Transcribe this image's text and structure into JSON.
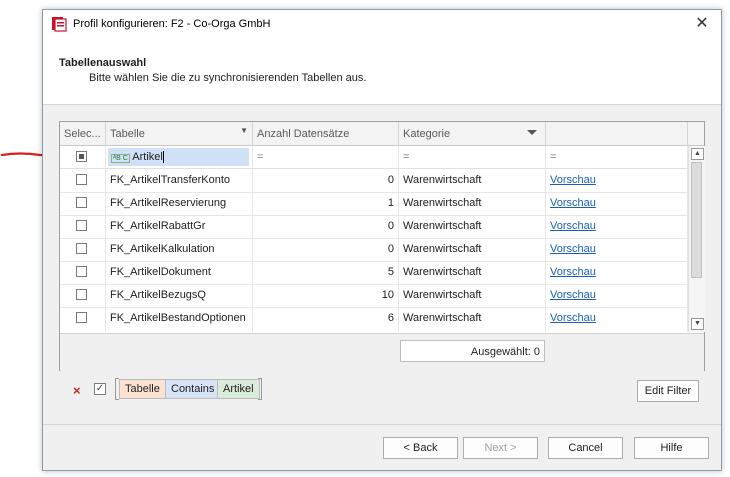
{
  "window": {
    "title": "Profil konfigurieren: F2 - Co-Orga GmbH",
    "close": "✕"
  },
  "header": {
    "title": "Tabellenauswahl",
    "subtitle": "Bitte wählen Sie die zu synchronisierenden Tabellen aus."
  },
  "grid": {
    "columns": [
      "Selec...",
      "Tabelle",
      "Anzahl Datensätze",
      "Kategorie",
      ""
    ],
    "filter_row": {
      "tabelle_prefix": "ᴬB C",
      "tabelle_value": "Artikel",
      "anzahl": "=",
      "kategorie": "=",
      "extra": "="
    },
    "rows": [
      {
        "tabelle": "FK_ArtikelTransferKonto",
        "anzahl": "0",
        "kategorie": "Warenwirtschaft",
        "link": "Vorschau"
      },
      {
        "tabelle": "FK_ArtikelReservierung",
        "anzahl": "1",
        "kategorie": "Warenwirtschaft",
        "link": "Vorschau"
      },
      {
        "tabelle": "FK_ArtikelRabattGr",
        "anzahl": "0",
        "kategorie": "Warenwirtschaft",
        "link": "Vorschau"
      },
      {
        "tabelle": "FK_ArtikelKalkulation",
        "anzahl": "0",
        "kategorie": "Warenwirtschaft",
        "link": "Vorschau"
      },
      {
        "tabelle": "FK_ArtikelDokument",
        "anzahl": "5",
        "kategorie": "Warenwirtschaft",
        "link": "Vorschau"
      },
      {
        "tabelle": "FK_ArtikelBezugsQ",
        "anzahl": "10",
        "kategorie": "Warenwirtschaft",
        "link": "Vorschau"
      },
      {
        "tabelle": "FK_ArtikelBestandOptionen",
        "anzahl": "6",
        "kategorie": "Warenwirtschaft",
        "link": "Vorschau"
      }
    ],
    "selected_summary": "Ausgewählt: 0"
  },
  "filter_bar": {
    "clear": "×",
    "enabled": "✓",
    "chips": [
      "Tabelle",
      "Contains",
      "Artikel"
    ],
    "edit": "Edit Filter"
  },
  "buttons": {
    "back": "< Back",
    "next": "Next >",
    "cancel": "Cancel",
    "help": "Hilfe"
  },
  "colors": {
    "link": "#1a5fb4",
    "arrow": "#d42020",
    "chip_field": "#fde2d2",
    "chip_op": "#d7e3f7",
    "chip_value": "#d9ecd9"
  }
}
